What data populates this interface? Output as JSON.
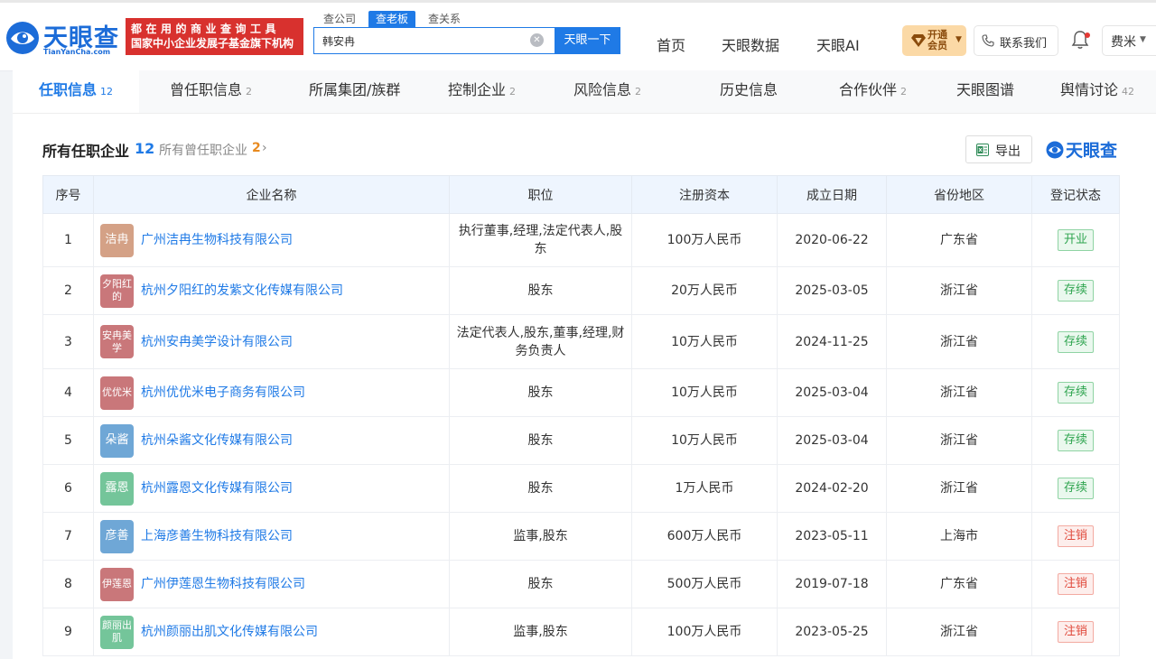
{
  "header": {
    "logo_text": "天眼查",
    "logo_sub": "TianYanCha.com",
    "slogan_line1": "都在用的商业查询工具",
    "slogan_line2": "国家中小企业发展子基金旗下机构",
    "search_tabs": [
      "查公司",
      "查老板",
      "查关系"
    ],
    "search_value": "韩安冉",
    "search_button": "天眼一下",
    "nav": [
      "首页",
      "天眼数据",
      "天眼AI"
    ],
    "vip_label": "开通会员",
    "contact_label": "联系我们",
    "user_label": "费米"
  },
  "tabs": [
    {
      "label": "任职信息",
      "count": "12"
    },
    {
      "label": "曾任职信息",
      "count": "2"
    },
    {
      "label": "所属集团/族群",
      "count": ""
    },
    {
      "label": "控制企业",
      "count": "2"
    },
    {
      "label": "风险信息",
      "count": "2"
    },
    {
      "label": "历史信息",
      "count": ""
    },
    {
      "label": "合作伙伴",
      "count": "2"
    },
    {
      "label": "天眼图谱",
      "count": ""
    },
    {
      "label": "舆情讨论",
      "count": "42"
    }
  ],
  "section": {
    "title": "所有任职企业",
    "count": "12",
    "link_label": "所有曾任职企业",
    "link_count": "2",
    "export_label": "导出",
    "brand": "天眼查"
  },
  "table": {
    "columns": [
      "序号",
      "企业名称",
      "职位",
      "注册资本",
      "成立日期",
      "省份地区",
      "登记状态"
    ],
    "rows": [
      {
        "no": "1",
        "avatar": "洁冉",
        "avatar_color": "#d4a186",
        "name": "广州洁冉生物科技有限公司",
        "position": "执行董事,经理,法定代表人,股东",
        "capital": "100万人民币",
        "date": "2020-06-22",
        "region": "广东省",
        "status": "开业",
        "status_type": "open"
      },
      {
        "no": "2",
        "avatar": "夕阳红的",
        "avatar_color": "#c9777a",
        "name": "杭州夕阳红的发紫文化传媒有限公司",
        "position": "股东",
        "capital": "20万人民币",
        "date": "2025-03-05",
        "region": "浙江省",
        "status": "存续",
        "status_type": "live"
      },
      {
        "no": "3",
        "avatar": "安冉美学",
        "avatar_color": "#c9777a",
        "name": "杭州安冉美学设计有限公司",
        "position": "法定代表人,股东,董事,经理,财务负责人",
        "capital": "10万人民币",
        "date": "2024-11-25",
        "region": "浙江省",
        "status": "存续",
        "status_type": "live"
      },
      {
        "no": "4",
        "avatar": "优优米",
        "avatar_color": "#c9777a",
        "name": "杭州优优米电子商务有限公司",
        "position": "股东",
        "capital": "10万人民币",
        "date": "2025-03-04",
        "region": "浙江省",
        "status": "存续",
        "status_type": "live"
      },
      {
        "no": "5",
        "avatar": "朵酱",
        "avatar_color": "#6fa7d6",
        "name": "杭州朵酱文化传媒有限公司",
        "position": "股东",
        "capital": "10万人民币",
        "date": "2025-03-04",
        "region": "浙江省",
        "status": "存续",
        "status_type": "live"
      },
      {
        "no": "6",
        "avatar": "露恩",
        "avatar_color": "#74c59a",
        "name": "杭州露恩文化传媒有限公司",
        "position": "股东",
        "capital": "1万人民币",
        "date": "2024-02-20",
        "region": "浙江省",
        "status": "存续",
        "status_type": "live"
      },
      {
        "no": "7",
        "avatar": "彦善",
        "avatar_color": "#6fa7d6",
        "name": "上海彦善生物科技有限公司",
        "position": "监事,股东",
        "capital": "600万人民币",
        "date": "2023-05-11",
        "region": "上海市",
        "status": "注销",
        "status_type": "dead"
      },
      {
        "no": "8",
        "avatar": "伊莲恩",
        "avatar_color": "#c9777a",
        "name": "广州伊莲恩生物科技有限公司",
        "position": "股东",
        "capital": "500万人民币",
        "date": "2019-07-18",
        "region": "广东省",
        "status": "注销",
        "status_type": "dead"
      },
      {
        "no": "9",
        "avatar": "颜丽出肌",
        "avatar_color": "#74c59a",
        "name": "杭州颜丽出肌文化传媒有限公司",
        "position": "监事,股东",
        "capital": "100万人民币",
        "date": "2023-05-25",
        "region": "浙江省",
        "status": "注销",
        "status_type": "dead"
      }
    ]
  }
}
